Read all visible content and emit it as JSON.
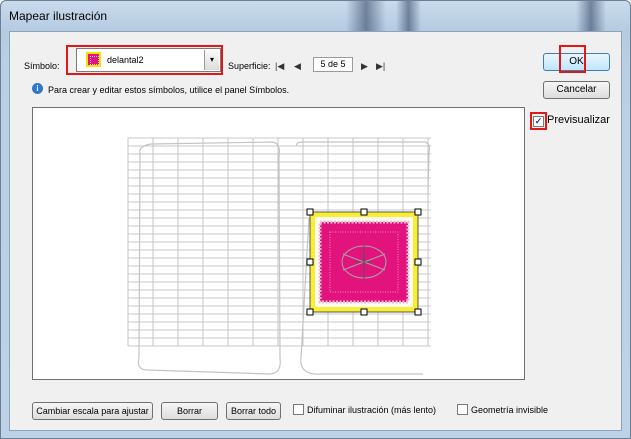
{
  "window": {
    "title": "Mapear ilustración"
  },
  "symbol": {
    "label": "Símbolo:",
    "selected": "delantal2",
    "swatch_color": "#e2137c",
    "border_color": "#f5e400"
  },
  "surface": {
    "label": "Superficie:",
    "page": "5 de 5",
    "first_icon": "first-page-icon",
    "prev_icon": "prev-page-icon",
    "next_icon": "next-page-icon",
    "last_icon": "last-page-icon"
  },
  "info": {
    "text": "Para crear y editar estos símbolos, utilice el panel Símbolos.",
    "icon": "info-icon"
  },
  "buttons": {
    "ok": "OK",
    "cancel": "Cancelar",
    "scale": "Cambiar escala para ajustar",
    "clear": "Borrar",
    "clear_all": "Borrar todo"
  },
  "options": {
    "preview": "Previsualizar",
    "preview_checked": true,
    "shade": "Difuminar ilustración (más lento)",
    "shade_checked": false,
    "invisible": "Geometría invisible",
    "invisible_checked": false
  },
  "colors": {
    "highlight": "#e01818",
    "artwork": "#e2137c",
    "artwork_border": "#f5e400"
  }
}
